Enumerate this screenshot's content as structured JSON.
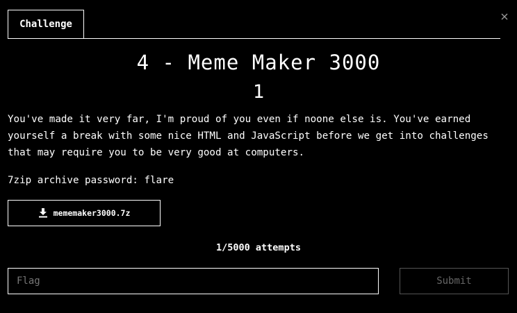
{
  "tab": {
    "label": "Challenge"
  },
  "close_icon": "close-icon",
  "challenge": {
    "title": "4 - Meme Maker 3000",
    "points": "1",
    "description": "You've made it very far, I'm proud of you even if noone else is. You've earned yourself a break with some nice HTML and JavaScript before we get into challenges that may require you to be very good at computers.",
    "archive_password": "7zip archive password: flare",
    "file": {
      "name": "mememaker3000.7z",
      "icon": "download-icon"
    },
    "attempts": "1/5000 attempts"
  },
  "form": {
    "flag_placeholder": "Flag",
    "flag_value": "",
    "submit_label": "Submit"
  }
}
